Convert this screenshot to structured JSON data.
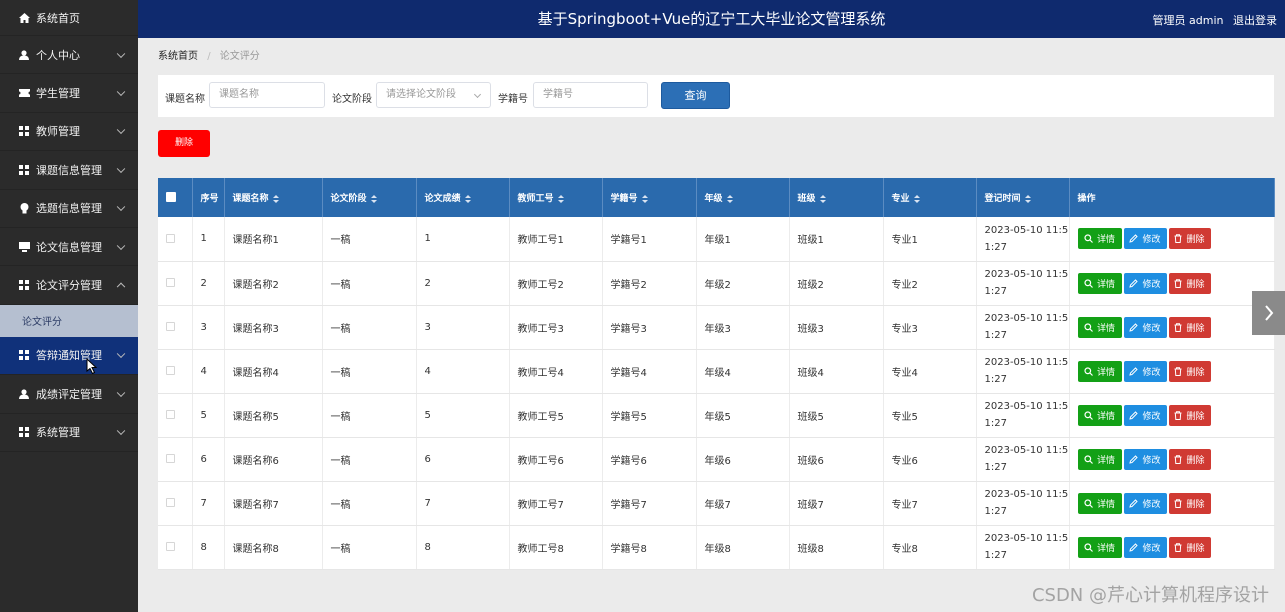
{
  "header": {
    "title": "基于Springboot+Vue的辽宁工大毕业论文管理系统",
    "user_label": "管理员 admin",
    "logout_label": "退出登录"
  },
  "sidebar": {
    "items": [
      {
        "label": "系统首页",
        "icon": "home-icon"
      },
      {
        "label": "个人中心",
        "icon": "user-icon"
      },
      {
        "label": "学生管理",
        "icon": "ticket-icon"
      },
      {
        "label": "教师管理",
        "icon": "grid-icon"
      },
      {
        "label": "课题信息管理",
        "icon": "grid-icon"
      },
      {
        "label": "选题信息管理",
        "icon": "bulb-icon"
      },
      {
        "label": "论文信息管理",
        "icon": "monitor-icon"
      },
      {
        "label": "论文评分管理",
        "icon": "grid-icon"
      },
      {
        "label": "答辩通知管理",
        "icon": "grid-icon"
      },
      {
        "label": "成绩评定管理",
        "icon": "user-icon"
      },
      {
        "label": "系统管理",
        "icon": "grid-icon"
      }
    ],
    "subitem": "论文评分"
  },
  "breadcrumb": {
    "home": "系统首页",
    "sep": "/",
    "current": "论文评分"
  },
  "search": {
    "title_label": "课题名称",
    "title_placeholder": "课题名称",
    "stage_label": "论文阶段",
    "stage_placeholder": "请选择论文阶段",
    "student_label": "学籍号",
    "student_placeholder": "学籍号",
    "query_label": "查询"
  },
  "delete_label": "删除",
  "table": {
    "columns": [
      "序号",
      "课题名称",
      "论文阶段",
      "论文成绩",
      "教师工号",
      "学籍号",
      "年级",
      "班级",
      "专业",
      "登记时间",
      "操作"
    ],
    "actions": {
      "detail": "详情",
      "edit": "修改",
      "delete": "删除"
    },
    "rows": [
      {
        "no": "1",
        "title": "课题名称1",
        "stage": "一稿",
        "score": "1",
        "teacher": "教师工号1",
        "student": "学籍号1",
        "grade": "年级1",
        "class": "班级1",
        "major": "专业1",
        "time1": "2023-05-10 11:5",
        "time2": "1:27"
      },
      {
        "no": "2",
        "title": "课题名称2",
        "stage": "一稿",
        "score": "2",
        "teacher": "教师工号2",
        "student": "学籍号2",
        "grade": "年级2",
        "class": "班级2",
        "major": "专业2",
        "time1": "2023-05-10 11:5",
        "time2": "1:27"
      },
      {
        "no": "3",
        "title": "课题名称3",
        "stage": "一稿",
        "score": "3",
        "teacher": "教师工号3",
        "student": "学籍号3",
        "grade": "年级3",
        "class": "班级3",
        "major": "专业3",
        "time1": "2023-05-10 11:5",
        "time2": "1:27"
      },
      {
        "no": "4",
        "title": "课题名称4",
        "stage": "一稿",
        "score": "4",
        "teacher": "教师工号4",
        "student": "学籍号4",
        "grade": "年级4",
        "class": "班级4",
        "major": "专业4",
        "time1": "2023-05-10 11:5",
        "time2": "1:27"
      },
      {
        "no": "5",
        "title": "课题名称5",
        "stage": "一稿",
        "score": "5",
        "teacher": "教师工号5",
        "student": "学籍号5",
        "grade": "年级5",
        "class": "班级5",
        "major": "专业5",
        "time1": "2023-05-10 11:5",
        "time2": "1:27"
      },
      {
        "no": "6",
        "title": "课题名称6",
        "stage": "一稿",
        "score": "6",
        "teacher": "教师工号6",
        "student": "学籍号6",
        "grade": "年级6",
        "class": "班级6",
        "major": "专业6",
        "time1": "2023-05-10 11:5",
        "time2": "1:27"
      },
      {
        "no": "7",
        "title": "课题名称7",
        "stage": "一稿",
        "score": "7",
        "teacher": "教师工号7",
        "student": "学籍号7",
        "grade": "年级7",
        "class": "班级7",
        "major": "专业7",
        "time1": "2023-05-10 11:5",
        "time2": "1:27"
      },
      {
        "no": "8",
        "title": "课题名称8",
        "stage": "一稿",
        "score": "8",
        "teacher": "教师工号8",
        "student": "学籍号8",
        "grade": "年级8",
        "class": "班级8",
        "major": "专业8",
        "time1": "2023-05-10 11:5",
        "time2": "1:27"
      }
    ]
  },
  "watermark": "CSDN @芹心计算机程序设计",
  "colors": {
    "header_bg": "#0f2a6e",
    "sidebar_bg": "#2b2b2b",
    "table_header_bg": "#2a6aad",
    "query_button": "#2c6fb6",
    "delete_button": "#ff0000",
    "detail_button": "#13a016",
    "edit_button": "#1e8ee1",
    "row_delete_button": "#d03a33"
  }
}
